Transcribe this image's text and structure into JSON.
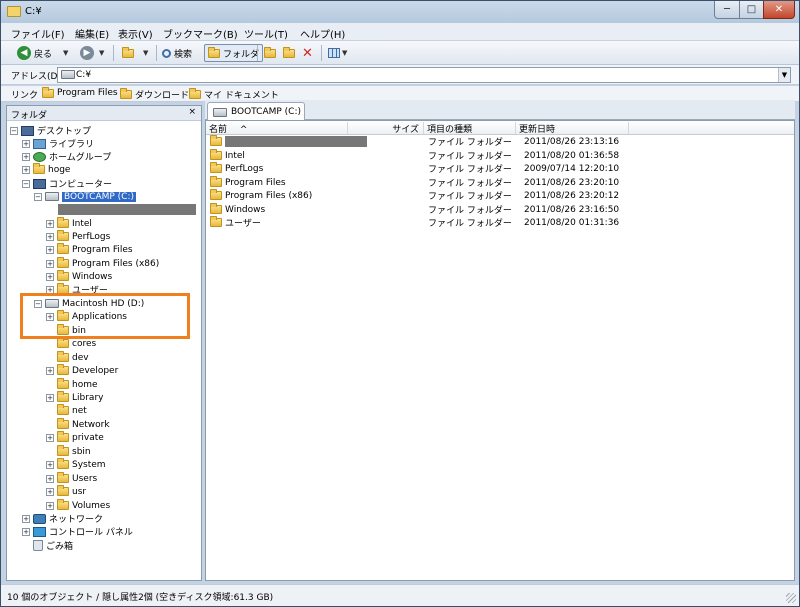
{
  "window": {
    "title": "C:¥"
  },
  "window_buttons": {
    "minimize": "─",
    "maximize": "□",
    "close": "✕"
  },
  "menu": [
    "ファイル(F)",
    "編集(E)",
    "表示(V)",
    "ブックマーク(B)",
    "ツール(T)",
    "ヘルプ(H)"
  ],
  "toolbar": {
    "back_label": "戻る",
    "search_label": "検索",
    "folders_label": "フォルダ"
  },
  "address": {
    "label": "アドレス(D)",
    "value": "C:¥"
  },
  "links": {
    "label": "リンク",
    "items": [
      "Program Files",
      "ダウンロード",
      "マイ ドキュメント"
    ]
  },
  "folder_pane": {
    "title": "フォルダ",
    "close": "×"
  },
  "tree": {
    "desktop": "デスクトップ",
    "library": "ライブラリ",
    "homegroup": "ホームグループ",
    "hoge": "hoge",
    "computer": "コンピューター",
    "bootcamp": "BOOTCAMP (C:)",
    "bootcamp_children": [
      "Intel",
      "PerfLogs",
      "Program Files",
      "Program Files (x86)",
      "Windows",
      "ユーザー"
    ],
    "mac": "Macintosh HD (D:)",
    "mac_children": [
      "Applications",
      "bin",
      "cores",
      "dev",
      "Developer",
      "home",
      "Library",
      "net",
      "Network",
      "private",
      "sbin",
      "System",
      "Users",
      "usr",
      "Volumes"
    ],
    "network": "ネットワーク",
    "control_panel": "コントロール パネル",
    "recycle": "ごみ箱"
  },
  "tab": {
    "label": "BOOTCAMP (C:)"
  },
  "columns": {
    "name": "名前",
    "sort": "^",
    "size": "サイズ",
    "type": "項目の種類",
    "date": "更新日時"
  },
  "files": [
    {
      "name": "",
      "type": "ファイル フォルダー",
      "date": "2011/08/26 23:13:16"
    },
    {
      "name": "Intel",
      "type": "ファイル フォルダー",
      "date": "2011/08/20 01:36:58"
    },
    {
      "name": "PerfLogs",
      "type": "ファイル フォルダー",
      "date": "2009/07/14 12:20:10"
    },
    {
      "name": "Program Files",
      "type": "ファイル フォルダー",
      "date": "2011/08/26 23:20:10"
    },
    {
      "name": "Program Files (x86)",
      "type": "ファイル フォルダー",
      "date": "2011/08/26 23:20:12"
    },
    {
      "name": "Windows",
      "type": "ファイル フォルダー",
      "date": "2011/08/26 23:16:50"
    },
    {
      "name": "ユーザー",
      "type": "ファイル フォルダー",
      "date": "2011/08/20 01:31:36"
    }
  ],
  "status": {
    "text": "10 個のオブジェクト / 隠し属性2個 (空きディスク領域:61.3 GB)"
  }
}
